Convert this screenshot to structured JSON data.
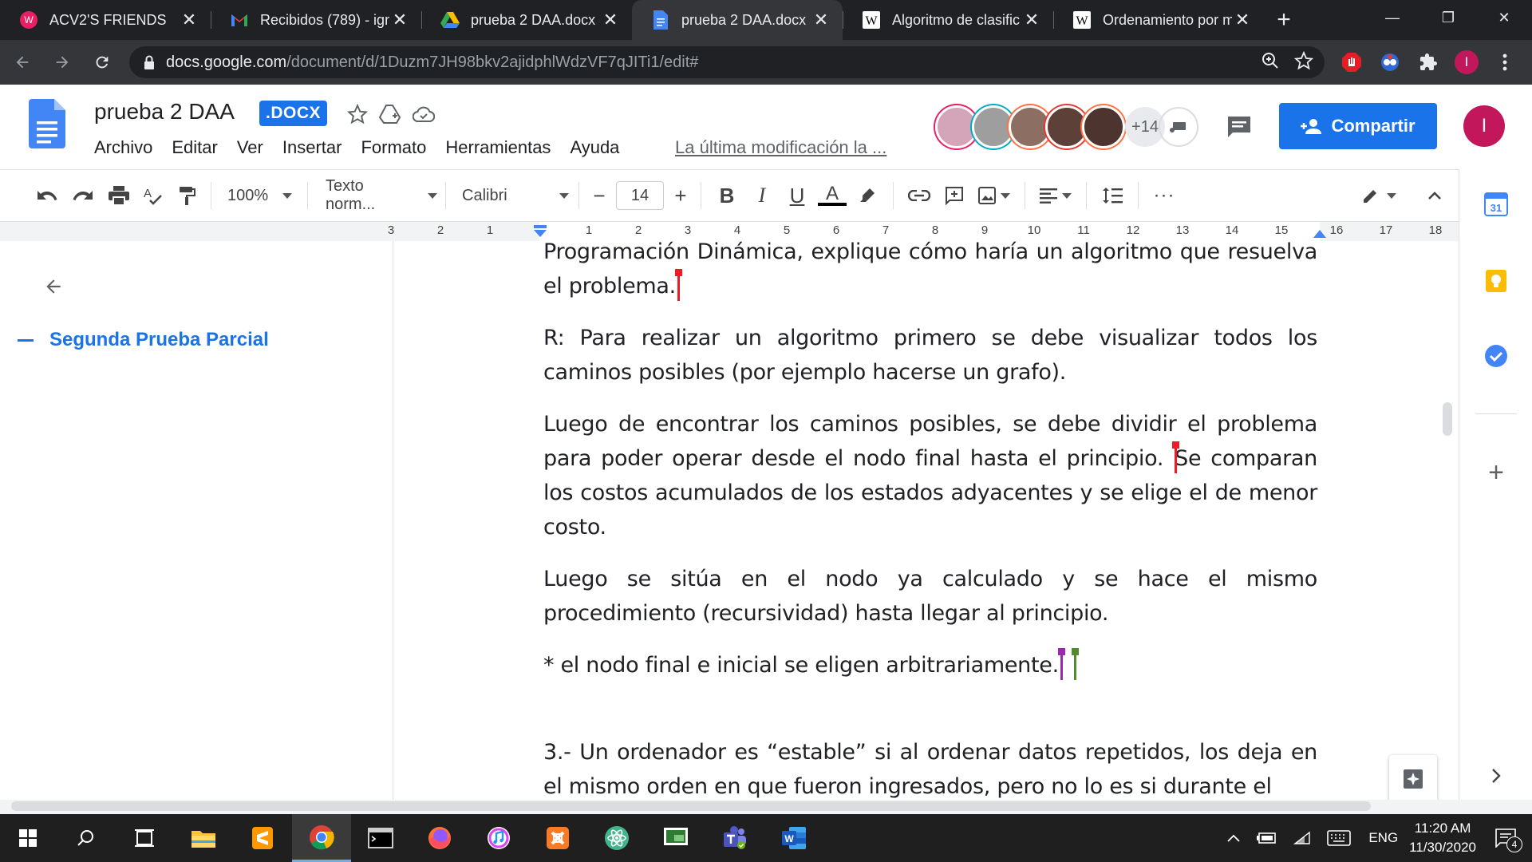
{
  "browser": {
    "tabs": [
      {
        "title": "ACV2'S FRIENDS",
        "icon": "twitch-icon"
      },
      {
        "title": "Recibidos (789) - ign",
        "icon": "gmail-icon"
      },
      {
        "title": "prueba 2 DAA.docx -",
        "icon": "drive-icon"
      },
      {
        "title": "prueba 2 DAA.docx -",
        "icon": "docs-icon",
        "active": true
      },
      {
        "title": "Algoritmo de clasific",
        "icon": "wikipedia-icon"
      },
      {
        "title": "Ordenamiento por m",
        "icon": "wikipedia-icon"
      }
    ],
    "url_host": "docs.google.com",
    "url_path": "/document/d/1Duzm7JH98bkv2ajidphlWdzVF7qJITi1/edit#",
    "profile_initial": "I"
  },
  "doc": {
    "title": "prueba 2 DAA",
    "badge": ".DOCX",
    "menu": [
      "Archivo",
      "Editar",
      "Ver",
      "Insertar",
      "Formato",
      "Herramientas",
      "Ayuda"
    ],
    "last_modified": "La última modificación la ...",
    "collaborators_more": "+14",
    "share_label": "Compartir",
    "user_initial": "I"
  },
  "toolbar": {
    "zoom": "100%",
    "style": "Texto norm...",
    "font": "Calibri",
    "font_size": "14"
  },
  "ruler": {
    "labels": [
      "3",
      "2",
      "1",
      "1",
      "2",
      "3",
      "4",
      "5",
      "6",
      "7",
      "8",
      "9",
      "10",
      "11",
      "12",
      "13",
      "14",
      "15",
      "16",
      "17",
      "18"
    ]
  },
  "outline": {
    "heading": "Segunda Prueba Parcial"
  },
  "content": {
    "p0": "Programación Dinámica, explique cómo haría un algoritmo que resuelva el problema.",
    "p1": "R: Para realizar un algoritmo primero se debe visualizar todos los caminos posibles (por ejemplo hacerse un grafo).",
    "p2a": "Luego de encontrar los caminos posibles, se debe dividir el problema para poder operar desde el nodo final hasta el principio. ",
    "p2b": "Se comparan los costos acumulados de los estados adyacentes y se elige el de menor costo.",
    "p3": "Luego se sitúa en el nodo ya calculado y se hace el mismo procedimiento (recursividad) hasta llegar al principio.",
    "p4": "* el nodo final e inicial se eligen arbitrariamente.",
    "p5": "3.- Un ordenador es “estable” si al ordenar datos repetidos, los deja en el mismo orden en que fueron ingresados, pero no lo es si durante el"
  },
  "taskbar": {
    "time": "11:20 AM",
    "date": "11/30/2020",
    "lang": "ENG",
    "notifications": "4"
  },
  "colors": {
    "accent": "#1a73e8",
    "cursor_red": "#ea1c24",
    "cursor_purple": "#9c27b0",
    "cursor_green": "#558b2f",
    "profile": "#c2185b"
  }
}
